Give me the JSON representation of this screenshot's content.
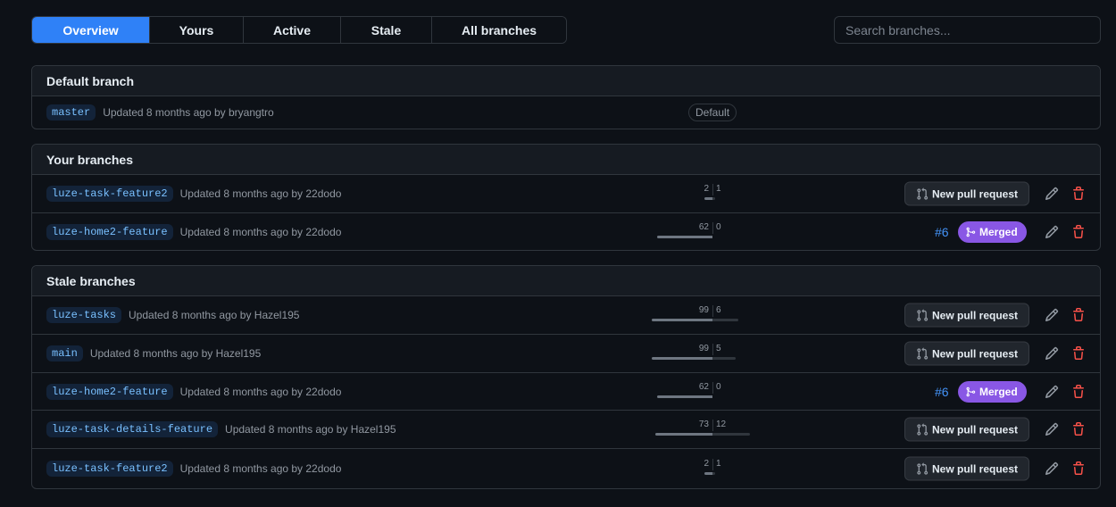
{
  "tabs": [
    "Overview",
    "Yours",
    "Active",
    "Stale",
    "All branches"
  ],
  "selected_tab": "Overview",
  "search": {
    "placeholder": "Search branches..."
  },
  "colors": {
    "accent": "#2f81f7",
    "merged": "#8957e5",
    "delete": "#f85149",
    "link": "#4493f8"
  },
  "default_branch": {
    "title": "Default branch",
    "name": "master",
    "updated": "Updated 8 months ago by bryangtro",
    "badge": "Default"
  },
  "your_branches": {
    "title": "Your branches",
    "rows": [
      {
        "name": "luze-task-feature2",
        "updated": "Updated 8 months ago by 22dodo",
        "behind": "2",
        "ahead": "1",
        "action": "New pull request",
        "icons": [
          "git-pull-request-icon",
          "pencil-icon",
          "trash-icon"
        ]
      },
      {
        "name": "luze-home2-feature",
        "updated": "Updated 8 months ago by 22dodo",
        "behind": "62",
        "ahead": "0",
        "pr_number": "#6",
        "status": "Merged",
        "icons": [
          "git-merge-icon",
          "pencil-icon",
          "trash-icon"
        ]
      }
    ]
  },
  "stale_branches": {
    "title": "Stale branches",
    "rows": [
      {
        "name": "luze-tasks",
        "updated": "Updated 8 months ago by Hazel195",
        "behind": "99",
        "ahead": "6",
        "action": "New pull request"
      },
      {
        "name": "main",
        "updated": "Updated 8 months ago by Hazel195",
        "behind": "99",
        "ahead": "5",
        "action": "New pull request"
      },
      {
        "name": "luze-home2-feature",
        "updated": "Updated 8 months ago by 22dodo",
        "behind": "62",
        "ahead": "0",
        "pr_number": "#6",
        "status": "Merged"
      },
      {
        "name": "luze-task-details-feature",
        "updated": "Updated 8 months ago by Hazel195",
        "behind": "73",
        "ahead": "12",
        "action": "New pull request"
      },
      {
        "name": "luze-task-feature2",
        "updated": "Updated 8 months ago by 22dodo",
        "behind": "2",
        "ahead": "1",
        "action": "New pull request"
      }
    ]
  }
}
